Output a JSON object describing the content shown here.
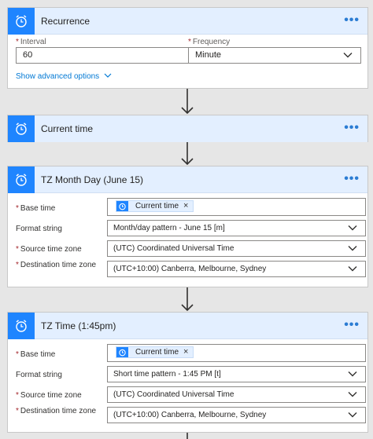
{
  "colors": {
    "accent": "#1f85ff",
    "header_bg": "#e3efff",
    "link": "#0078d4",
    "required": "#a4262c"
  },
  "required_mark": "*",
  "more_glyph": "•••",
  "recurrence": {
    "title": "Recurrence",
    "icon": "alarm-clock-icon",
    "interval_label": "Interval",
    "interval_value": "60",
    "frequency_label": "Frequency",
    "frequency_value": "Minute",
    "advanced_link": "Show advanced options"
  },
  "current_time": {
    "title": "Current time",
    "icon": "alarm-clock-icon"
  },
  "tz_month_day": {
    "title": "TZ Month Day (June 15)",
    "base_time_label": "Base time",
    "base_time_token": "Current time",
    "format_label": "Format string",
    "format_value": "Month/day pattern - June 15 [m]",
    "source_tz_label": "Source time zone",
    "source_tz_value": "(UTC) Coordinated Universal Time",
    "dest_tz_label": "Destination time zone",
    "dest_tz_value": "(UTC+10:00) Canberra, Melbourne, Sydney"
  },
  "tz_time": {
    "title": "TZ Time (1:45pm)",
    "base_time_label": "Base time",
    "base_time_token": "Current time",
    "format_label": "Format string",
    "format_value": "Short time pattern - 1:45 PM [t]",
    "source_tz_label": "Source time zone",
    "source_tz_value": "(UTC) Coordinated Universal Time",
    "dest_tz_label": "Destination time zone",
    "dest_tz_value": "(UTC+10:00) Canberra, Melbourne, Sydney"
  },
  "token_remove_glyph": "×"
}
